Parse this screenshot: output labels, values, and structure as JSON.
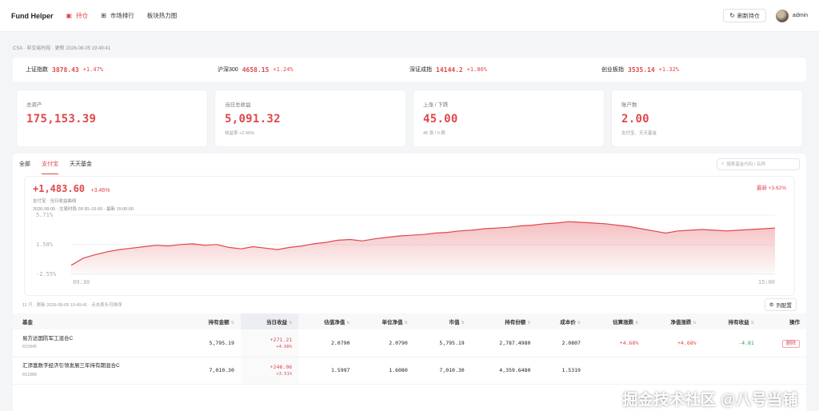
{
  "app": {
    "brand": "Fund Helper",
    "nav": [
      {
        "label": "持仓",
        "icon": "chart-icon",
        "active": true
      },
      {
        "label": "市场排行",
        "icon": "grid-icon",
        "active": false
      },
      {
        "label": "板块热力图",
        "icon": "",
        "active": false
      }
    ],
    "refresh_label": "刷新持仓",
    "user": "admin"
  },
  "status_line": "CSA · 非交易时段 · 更新 2026-08-05 19:49:41",
  "indices": [
    {
      "name": "上证指数",
      "value": "3878.43",
      "change": "+1.47%"
    },
    {
      "name": "沪深300",
      "value": "4658.15",
      "change": "+1.24%"
    },
    {
      "name": "深证成指",
      "value": "14144.2",
      "change": "+1.86%"
    },
    {
      "name": "创业板指",
      "value": "3535.14",
      "change": "+1.32%"
    }
  ],
  "cards": [
    {
      "label": "总资产",
      "value": "175,153.39",
      "sub": ""
    },
    {
      "label": "当日总收益",
      "value": "5,091.32",
      "sub": "收益率 +2.96%"
    },
    {
      "label": "上涨 / 下跌",
      "value": "45.00",
      "sub": "45 涨 / 0 跌"
    },
    {
      "label": "账户数",
      "value": "2.00",
      "sub": "支付宝、天天基金"
    }
  ],
  "tabs": [
    {
      "label": "全部",
      "active": false
    },
    {
      "label": "支付宝",
      "active": true
    },
    {
      "label": "天天基金",
      "active": false
    }
  ],
  "search_placeholder": "搜索基金代码 / 名称",
  "chart": {
    "gain": "+1,483.60",
    "gain_pct": "+3.46%",
    "subtitle": "支付宝 · 当日收益曲线",
    "meta": "2026-08-05 · 交易时段 09:30–15:00 · 最新 15:00:00",
    "latest": "最新 +3.62%"
  },
  "chart_data": {
    "type": "area",
    "x_start": "09:30",
    "x_end": "15:00",
    "yticks": [
      "5.71%",
      "1.58%",
      "-2.55%"
    ],
    "ylim": [
      -2.55,
      5.71
    ],
    "values": [
      -1.3,
      -0.3,
      0.2,
      0.6,
      0.9,
      1.1,
      1.3,
      1.5,
      1.4,
      1.6,
      1.7,
      1.5,
      1.6,
      1.2,
      1.0,
      1.3,
      1.1,
      0.9,
      1.2,
      1.4,
      1.7,
      1.9,
      2.2,
      2.3,
      2.1,
      2.4,
      2.6,
      2.8,
      2.9,
      3.0,
      3.2,
      3.3,
      3.5,
      3.6,
      3.8,
      3.9,
      4.0,
      4.2,
      4.3,
      4.5,
      4.6,
      4.8,
      4.7,
      4.6,
      4.5,
      4.3,
      4.1,
      3.8,
      3.5,
      3.2,
      3.5,
      3.6,
      3.7,
      3.6,
      3.5,
      3.6,
      3.7,
      3.8,
      3.9
    ],
    "color": "#e0474c"
  },
  "table_meta": {
    "left": "11 只 · 更新 2026-08-05 19:49:41 · 点击表头可排序",
    "columns_button": "列配置"
  },
  "table": {
    "headers": [
      "基金",
      "持有金额",
      "当日收益",
      "估值净值",
      "单位净值",
      "市值",
      "持有份额",
      "成本价",
      "估算涨跌",
      "净值涨跌",
      "持有收益",
      "操作"
    ],
    "rows": [
      {
        "name": "易方达国防军工混合C",
        "code": "015945",
        "amount": "5,795.19",
        "gain": "+271.21",
        "gain_pct": "+4.68%",
        "est_nav": "2.0790",
        "unit_nav": "2.0790",
        "market_value": "5,795.19",
        "shares": "2,787.4980",
        "cost": "2.0807",
        "est_change": "+4.68%",
        "nav_change": "+4.68%",
        "hold_gain": "-4.81",
        "action": "删除"
      },
      {
        "name": "汇添富数字经济引领发展三年持有期混合C",
        "code": "011886",
        "amount": "7,010.30",
        "gain": "+246.06",
        "gain_pct": "+3.51%",
        "est_nav": "1.5997",
        "unit_nav": "1.6080",
        "market_value": "7,010.30",
        "shares": "4,359.6480",
        "cost": "1.5319",
        "est_change": "",
        "nav_change": "",
        "hold_gain": "",
        "action": ""
      }
    ]
  },
  "watermark": "掘金技术社区 @八号当铺"
}
